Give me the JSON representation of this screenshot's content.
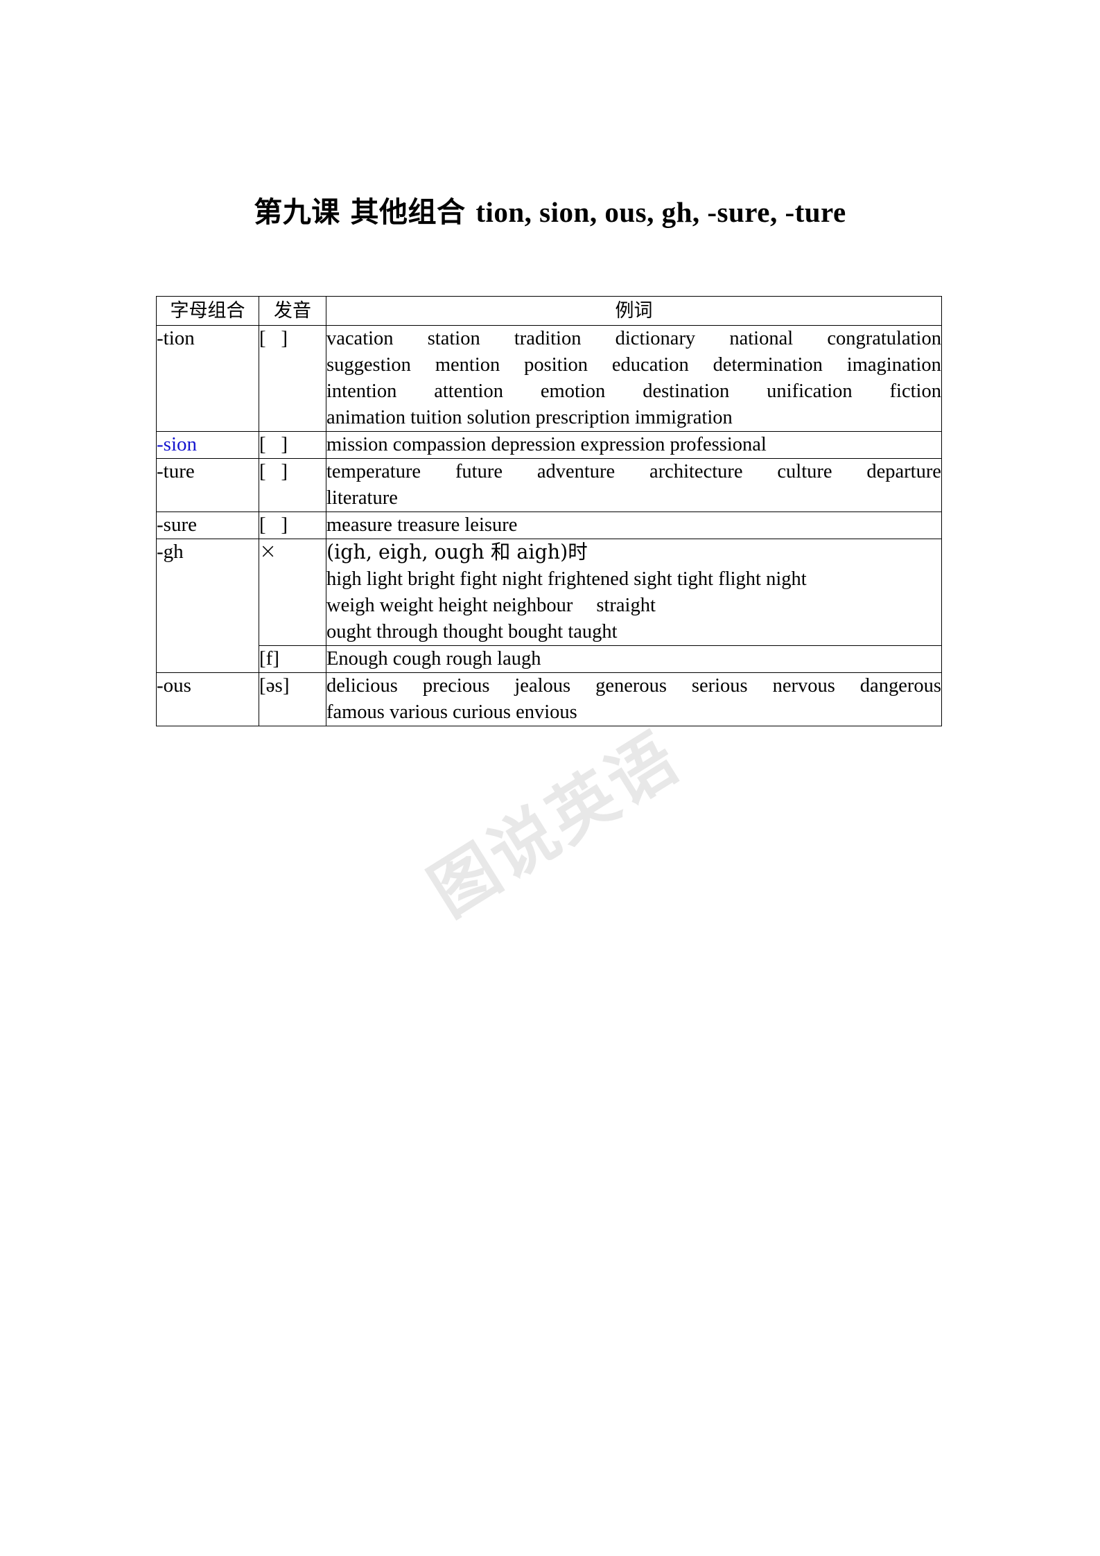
{
  "document": {
    "title_cn": "第九课  其他组合 ",
    "title_en": "tion, sion, ous, gh, -sure, -ture",
    "watermark": "图说英语"
  },
  "table": {
    "headers": {
      "combination": "字母组合",
      "pronunciation": "发音",
      "examples": "例词"
    },
    "rows": [
      {
        "combination": "-tion",
        "combination_color": "#000000",
        "pronunciation": "[   ]",
        "lines": [
          "vacation station tradition dictionary national congratulation",
          "suggestion mention position education determination imagination",
          "intention attention emotion destination unification fiction",
          "animation tuition solution prescription immigration"
        ]
      },
      {
        "combination": "-sion",
        "combination_color": "#1414cf",
        "pronunciation": "[   ]",
        "lines": [
          "mission compassion depression expression professional"
        ]
      },
      {
        "combination": "-ture",
        "combination_color": "#000000",
        "pronunciation": "[   ]",
        "lines": [
          "temperature future adventure architecture culture departure",
          "literature"
        ]
      },
      {
        "combination": "-sure",
        "combination_color": "#000000",
        "pronunciation": "[   ]",
        "lines": [
          "measure treasure leisure"
        ]
      },
      {
        "combination": "-gh",
        "combination_color": "#000000",
        "pronunciation": "×",
        "lines": [
          "(igh, eigh, ough 和 aigh)时",
          "high light bright fight night frightened sight tight flight night",
          "weigh weight height neighbour     straight",
          "ought through thought bought taught"
        ]
      },
      {
        "combination": "",
        "combination_color": "#000000",
        "pronunciation": "[f]",
        "lines": [
          "Enough cough rough laugh"
        ]
      },
      {
        "combination": "-ous",
        "combination_color": "#000000",
        "pronunciation": "[əs]",
        "lines": [
          "delicious precious jealous generous serious nervous dangerous",
          "famous various curious envious"
        ]
      }
    ]
  }
}
